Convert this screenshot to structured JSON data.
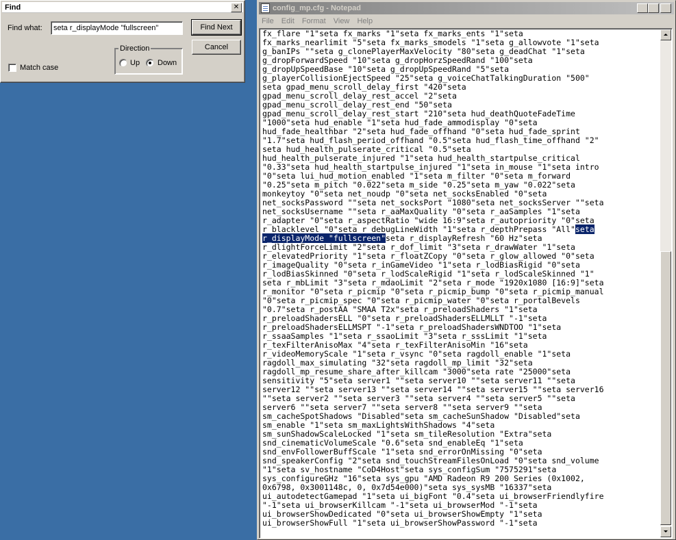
{
  "find_dialog": {
    "title": "Find",
    "find_what_label": "Find what:",
    "find_what_value": "seta r_displayMode \"fullscreen\"",
    "find_next_label": "Find Next",
    "cancel_label": "Cancel",
    "direction_label": "Direction",
    "up_label": "Up",
    "down_label": "Down",
    "direction_selected": "Down",
    "match_case_label": "Match case",
    "match_case_checked": false
  },
  "notepad": {
    "title": "config_mp.cfg - Notepad",
    "menu": [
      "File",
      "Edit",
      "Format",
      "View",
      "Help"
    ],
    "text_before_highlight": "fx_flare \"1\"seta fx_marks \"1\"seta fx_marks_ents \"1\"seta\nfx_marks_nearlimit \"5\"seta fx_marks_smodels \"1\"seta g_allowvote \"1\"seta\ng_banIPs \"\"seta g_clonePlayerMaxVelocity \"80\"seta g_deadChat \"1\"seta\ng_dropForwardSpeed \"10\"seta g_dropHorzSpeedRand \"100\"seta\ng_dropUpSpeedBase \"10\"seta g_dropUpSpeedRand \"5\"seta\ng_playerCollisionEjectSpeed \"25\"seta g_voiceChatTalkingDuration \"500\"\nseta gpad_menu_scroll_delay_first \"420\"seta\ngpad_menu_scroll_delay_rest_accel \"2\"seta\ngpad_menu_scroll_delay_rest_end \"50\"seta\ngpad_menu_scroll_delay_rest_start \"210\"seta hud_deathQuoteFadeTime\n\"1000\"seta hud_enable \"1\"seta hud_fade_ammodisplay \"0\"seta\nhud_fade_healthbar \"2\"seta hud_fade_offhand \"0\"seta hud_fade_sprint\n\"1.7\"seta hud_flash_period_offhand \"0.5\"seta hud_flash_time_offhand \"2\"\nseta hud_health_pulserate_critical \"0.5\"seta\nhud_health_pulserate_injured \"1\"seta hud_health_startpulse_critical\n\"0.33\"seta hud_health_startpulse_injured \"1\"seta in_mouse \"1\"seta intro\n\"0\"seta lui_hud_motion_enabled \"1\"seta m_filter \"0\"seta m_forward\n\"0.25\"seta m_pitch \"0.022\"seta m_side \"0.25\"seta m_yaw \"0.022\"seta\nmonkeytoy \"0\"seta net_noudp \"0\"seta net_socksEnabled \"0\"seta\nnet_socksPassword \"\"seta net_socksPort \"1080\"seta net_socksServer \"\"seta\nnet_socksUsername \"\"seta r_aaMaxQuality \"0\"seta r_aaSamples \"1\"seta\nr_adapter \"0\"seta r_aspectRatio \"wide 16:9\"seta r_autopriority \"0\"seta\nr_blacklevel \"0\"seta r_debugLineWidth \"1\"seta r_depthPrepass \"All\"",
    "highlight_line1": "seta",
    "highlight_line2": "r_displayMode \"fullscreen\"",
    "text_after_highlight": "seta r_displayRefresh \"60 Hz\"seta\nr_dlightForceLimit \"2\"seta r_dof_limit \"3\"seta r_drawWater \"1\"seta\nr_elevatedPriority \"1\"seta r_floatZCopy \"0\"seta r_glow_allowed \"0\"seta\nr_imageQuality \"0\"seta r_inGameVideo \"1\"seta r_lodBiasRigid \"0\"seta\nr_lodBiasSkinned \"0\"seta r_lodScaleRigid \"1\"seta r_lodScaleSkinned \"1\"\nseta r_mbLimit \"3\"seta r_mdaoLimit \"2\"seta r_mode \"1920x1080 [16:9]\"seta\nr_monitor \"0\"seta r_picmip \"0\"seta r_picmip_bump \"0\"seta r_picmip_manual\n\"0\"seta r_picmip_spec \"0\"seta r_picmip_water \"0\"seta r_portalBevels\n\"0.7\"seta r_postAA \"SMAA T2x\"seta r_preloadShaders \"1\"seta\nr_preloadShadersELL \"0\"seta r_preloadShadersELLMLLT \"-1\"seta\nr_preloadShadersELLMSPT \"-1\"seta r_preloadShadersWNDTOO \"1\"seta\nr_ssaaSamples \"1\"seta r_ssaoLimit \"3\"seta r_sssLimit \"1\"seta\nr_texFilterAnisoMax \"4\"seta r_texFilterAnisoMin \"16\"seta\nr_videoMemoryScale \"1\"seta r_vsync \"0\"seta ragdoll_enable \"1\"seta\nragdoll_max_simulating \"32\"seta ragdoll_mp_limit \"32\"seta\nragdoll_mp_resume_share_after_killcam \"3000\"seta rate \"25000\"seta\nsensitivity \"5\"seta server1 \"\"seta server10 \"\"seta server11 \"\"seta\nserver12 \"\"seta server13 \"\"seta server14 \"\"seta server15 \"\"seta server16\n\"\"seta server2 \"\"seta server3 \"\"seta server4 \"\"seta server5 \"\"seta\nserver6 \"\"seta server7 \"\"seta server8 \"\"seta server9 \"\"seta\nsm_cacheSpotShadows \"Disabled\"seta sm_cacheSunShadow \"Disabled\"seta\nsm_enable \"1\"seta sm_maxLightsWithShadows \"4\"seta\nsm_sunShadowScaleLocked \"1\"seta sm_tileResolution \"Extra\"seta\nsnd_cinematicVolumeScale \"0.6\"seta snd_enableEq \"1\"seta\nsnd_envFollowerBuffScale \"1\"seta snd_errorOnMissing \"0\"seta\nsnd_speakerConfig \"2\"seta snd_touchStreamFilesOnLoad \"0\"seta snd_volume\n\"1\"seta sv_hostname \"CoD4Host\"seta sys_configSum \"7575291\"seta\nsys_configureGHz \"16\"seta sys_gpu \"AMD Radeon R9 200 Series (0x1002,\n0x6798, 0x3001148c, 0, 0x7d54e000)\"seta sys_sysMB \"16337\"seta\nui_autodetectGamepad \"1\"seta ui_bigFont \"0.4\"seta ui_browserFriendlyfire\n\"-1\"seta ui_browserKillcam \"-1\"seta ui_browserMod \"-1\"seta\nui_browserShowDedicated \"0\"seta ui_browserShowEmpty \"1\"seta\nui_browserShowFull \"1\"seta ui_browserShowPassword \"-1\"seta"
  }
}
